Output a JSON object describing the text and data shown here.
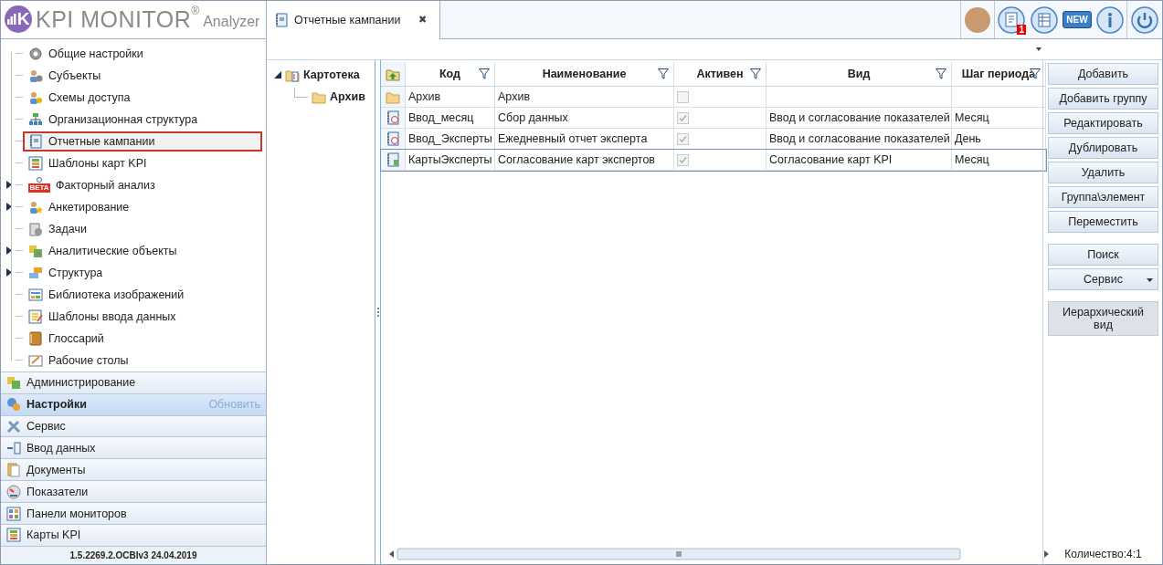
{
  "logo": {
    "mark": "K",
    "name": "KPI MONITOR",
    "reg": "®",
    "suffix": "Analyzer"
  },
  "sidebar": {
    "items": [
      {
        "label": "Общие настройки",
        "expandable": false,
        "selected": false
      },
      {
        "label": "Субъекты",
        "expandable": false,
        "selected": false
      },
      {
        "label": "Схемы доступа",
        "expandable": false,
        "selected": false
      },
      {
        "label": "Организационная структура",
        "expandable": false,
        "selected": false
      },
      {
        "label": "Отчетные кампании",
        "expandable": false,
        "selected": true
      },
      {
        "label": "Шаблоны карт KPI",
        "expandable": false,
        "selected": false
      },
      {
        "label": "Факторный анализ",
        "expandable": true,
        "selected": false,
        "badge": "BETA"
      },
      {
        "label": "Анкетирование",
        "expandable": true,
        "selected": false
      },
      {
        "label": "Задачи",
        "expandable": false,
        "selected": false
      },
      {
        "label": "Аналитические объекты",
        "expandable": true,
        "selected": false
      },
      {
        "label": "Структура",
        "expandable": true,
        "selected": false
      },
      {
        "label": "Библиотека изображений",
        "expandable": false,
        "selected": false
      },
      {
        "label": "Шаблоны ввода данных",
        "expandable": false,
        "selected": false
      },
      {
        "label": "Глоссарий",
        "expandable": false,
        "selected": false
      },
      {
        "label": "Рабочие столы",
        "expandable": false,
        "selected": false
      }
    ],
    "sections": [
      {
        "label": "Администрирование",
        "selected": false
      },
      {
        "label": "Настройки",
        "selected": true,
        "action": "Обновить"
      },
      {
        "label": "Сервис",
        "selected": false
      },
      {
        "label": "Ввод данных",
        "selected": false
      },
      {
        "label": "Документы",
        "selected": false
      },
      {
        "label": "Показатели",
        "selected": false
      },
      {
        "label": "Панели мониторов",
        "selected": false
      },
      {
        "label": "Карты KPI",
        "selected": false
      }
    ],
    "version": "1.5.2269.2.OCBIv3  24.04.2019"
  },
  "tabs": [
    {
      "label": "Отчетные кампании",
      "close": "✖",
      "selected": true
    }
  ],
  "header_icons": {
    "notification_badge": "1",
    "new_label": "NEW"
  },
  "folder_tree": [
    {
      "label": "Картотека",
      "expanded": true,
      "children": [
        {
          "label": "Архив"
        }
      ]
    }
  ],
  "table": {
    "columns": [
      "Код",
      "Наименование",
      "Активен",
      "Вид",
      "Шаг периода"
    ],
    "rows": [
      {
        "kind": "folder",
        "code": "Архив",
        "name": "Архив",
        "active": false,
        "type": "",
        "step": "",
        "selected": false
      },
      {
        "kind": "campaign",
        "code": "Ввод_месяц",
        "name": "Сбор данных",
        "active": true,
        "type": "Ввод и согласование показателей",
        "step": "Месяц",
        "selected": false
      },
      {
        "kind": "campaign",
        "code": "Ввод_Эксперты",
        "name": "Ежедневный отчет эксперта",
        "active": true,
        "type": "Ввод и согласование показателей",
        "step": "День",
        "selected": false
      },
      {
        "kind": "cards",
        "code": "КартыЭксперты",
        "name": "Согласование карт экспертов",
        "active": true,
        "type": "Согласование карт KPI",
        "step": "Месяц",
        "selected": true
      }
    ]
  },
  "action_groups": [
    [
      {
        "label": "Добавить",
        "kind": "button"
      },
      {
        "label": "Добавить группу",
        "kind": "button"
      },
      {
        "label": "Редактировать",
        "kind": "button"
      },
      {
        "label": "Дублировать",
        "kind": "button"
      },
      {
        "label": "Удалить",
        "kind": "button"
      },
      {
        "label": "Группа\\элемент",
        "kind": "button"
      },
      {
        "label": "Переместить",
        "kind": "button"
      }
    ],
    [
      {
        "label": "Поиск",
        "kind": "button"
      },
      {
        "label": "Сервис",
        "kind": "dropdown"
      }
    ],
    [
      {
        "label": "Иерархический вид",
        "kind": "toggle",
        "on": true
      }
    ]
  ],
  "status_bar": {
    "count": "Количество:4:1"
  }
}
